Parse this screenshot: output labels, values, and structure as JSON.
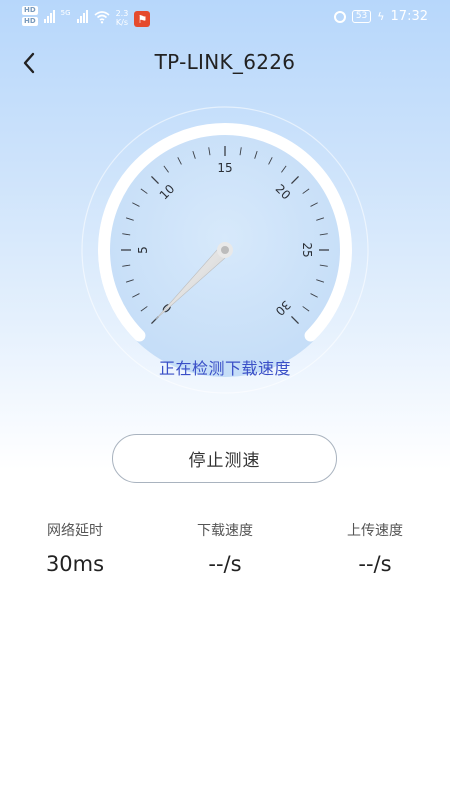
{
  "status_bar": {
    "hd_badges": [
      "HD",
      "HD"
    ],
    "net_type": "5G",
    "net_speed": "2.3",
    "net_speed_unit": "K/s",
    "battery": "53",
    "time": "17:32"
  },
  "header": {
    "title": "TP-LINK_6226"
  },
  "gauge": {
    "tick_labels": [
      "0",
      "5",
      "10",
      "15",
      "20",
      "25",
      "30"
    ],
    "min": 0,
    "max": 30,
    "needle_value": 0,
    "status": "正在检测下载速度",
    "colors": {
      "status_text": "#3a4fc7",
      "arc": "#ffffff",
      "needle": "#e6e6e6"
    }
  },
  "actions": {
    "stop_button": "停止测速"
  },
  "metrics": [
    {
      "label": "网络延时",
      "value": "30ms"
    },
    {
      "label": "下载速度",
      "value": "--/s"
    },
    {
      "label": "上传速度",
      "value": "--/s"
    }
  ]
}
